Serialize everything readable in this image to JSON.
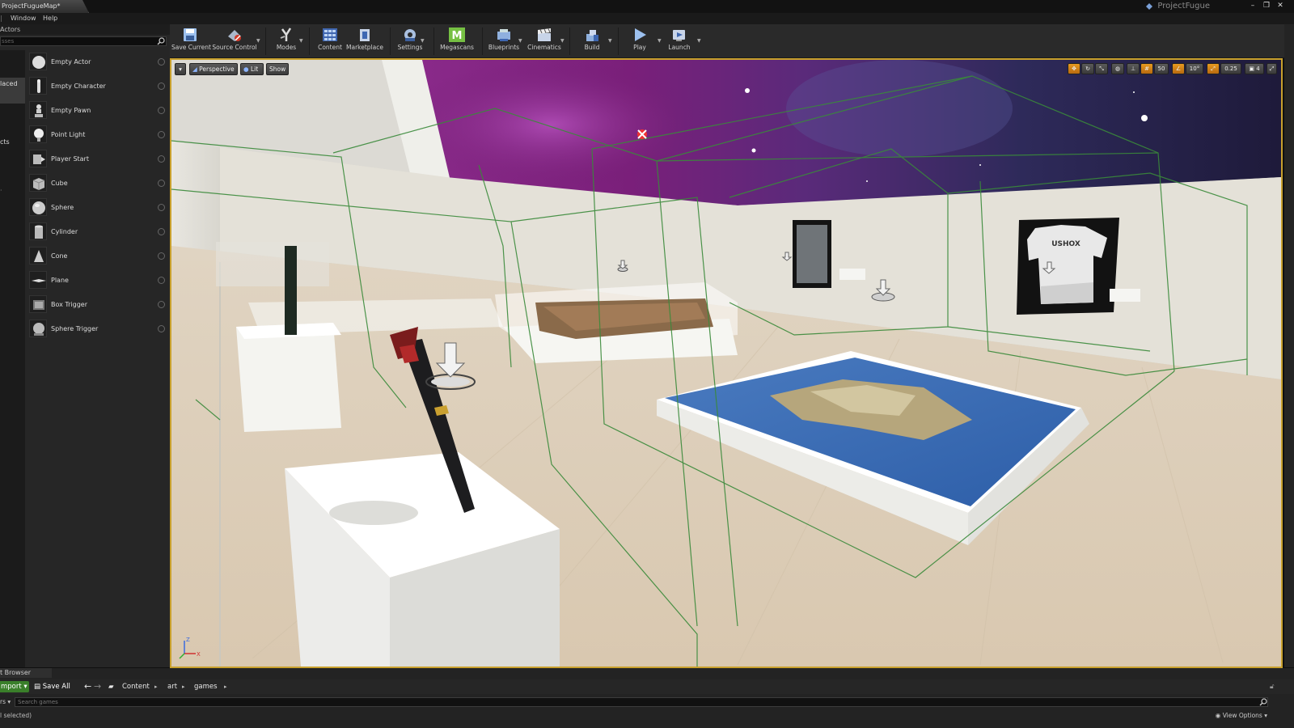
{
  "window": {
    "doc_tab": "ProjectFugueMap*",
    "project_name": "ProjectFugue",
    "buttons": [
      "–",
      "❐",
      "✕"
    ]
  },
  "menu": {
    "items": [
      "Window",
      "Help"
    ]
  },
  "place_actors": {
    "tab_title": "Actors",
    "search_placeholder": "sses",
    "categories": {
      "placed": "laced",
      "objects": "cts"
    },
    "items": [
      {
        "label": "Empty Actor",
        "icon": "sphere-icon"
      },
      {
        "label": "Empty Character",
        "icon": "character-icon"
      },
      {
        "label": "Empty Pawn",
        "icon": "pawn-icon"
      },
      {
        "label": "Point Light",
        "icon": "light-bulb-icon"
      },
      {
        "label": "Player Start",
        "icon": "player-start-icon"
      },
      {
        "label": "Cube",
        "icon": "cube-icon"
      },
      {
        "label": "Sphere",
        "icon": "sphere-icon"
      },
      {
        "label": "Cylinder",
        "icon": "cylinder-icon"
      },
      {
        "label": "Cone",
        "icon": "cone-icon"
      },
      {
        "label": "Plane",
        "icon": "plane-icon"
      },
      {
        "label": "Box Trigger",
        "icon": "box-trigger-icon"
      },
      {
        "label": "Sphere Trigger",
        "icon": "sphere-trigger-icon"
      }
    ]
  },
  "toolbar": {
    "save_current": "Save Current",
    "source_control": "Source Control",
    "modes": "Modes",
    "content": "Content",
    "marketplace": "Marketplace",
    "settings": "Settings",
    "megascans": "Megascans",
    "blueprints": "Blueprints",
    "cinematics": "Cinematics",
    "build": "Build",
    "play": "Play",
    "launch": "Launch"
  },
  "viewport": {
    "menu_caret": "▾",
    "perspective": "Perspective",
    "lit": "Lit",
    "show": "Show",
    "grid_snap": "50",
    "rotation_snap": "10°",
    "scale_snap": "0.25",
    "camera_speed": "4",
    "shirt_brand": "USHOX",
    "axis": {
      "z": "Z",
      "x": "X"
    },
    "colors": {
      "selection_border": "#c8a02c",
      "volume_lines": "#3a8a3a"
    }
  },
  "content_browser": {
    "tab_title": "t Browser",
    "import": "mport ▾",
    "save_all": "Save All",
    "breadcrumbs": [
      "Content",
      "art",
      "games"
    ],
    "filters": "rs ▾",
    "search_placeholder": "Search games",
    "status": "l selected)",
    "view_options": "View Options ▾"
  }
}
